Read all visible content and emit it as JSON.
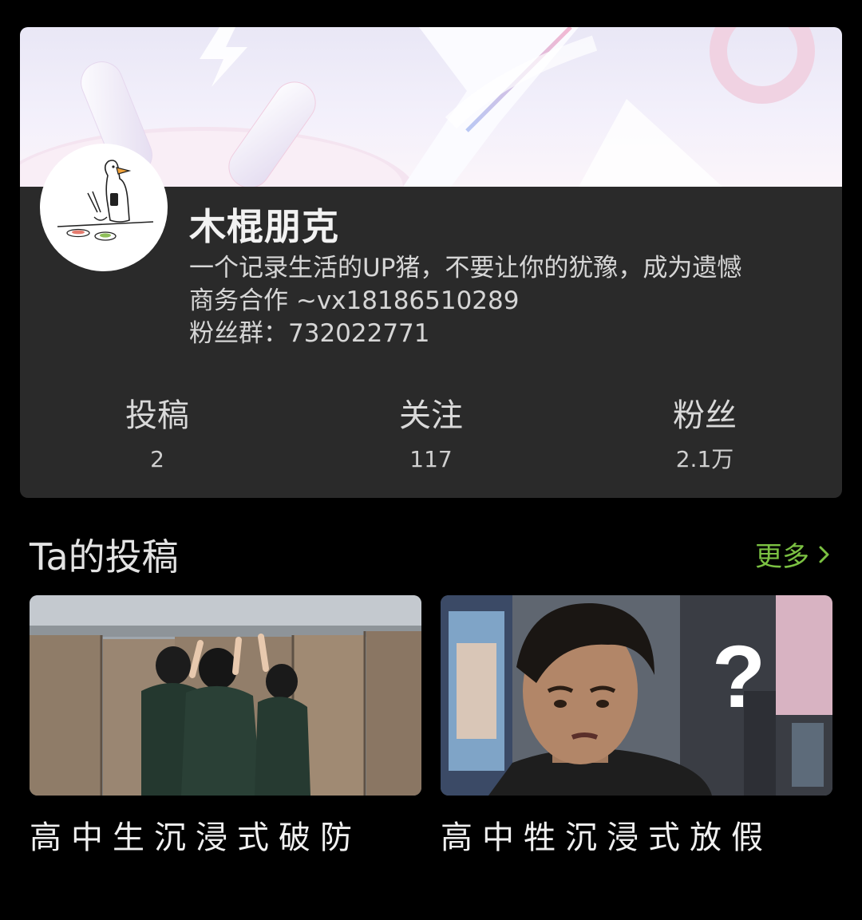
{
  "profile": {
    "username": "木棍朋克",
    "bio_lines": [
      "一个记录生活的UP猪，不要让你的犹豫，成为遗憾",
      "商务合作 ~vx18186510289",
      "粉丝群：732022771"
    ],
    "stats": [
      {
        "label": "投稿",
        "value": "2"
      },
      {
        "label": "关注",
        "value": "117"
      },
      {
        "label": "粉丝",
        "value": "2.1万"
      }
    ]
  },
  "posts_section": {
    "title": "Ta的投稿",
    "more_label": "更多",
    "more_icon": "chevron-right-icon"
  },
  "videos": [
    {
      "title": "高中生沉浸式破防"
    },
    {
      "title": "高中牲沉浸式放假"
    }
  ],
  "colors": {
    "background": "#000000",
    "card": "#2a2a2a",
    "accent": "#7bc142"
  }
}
